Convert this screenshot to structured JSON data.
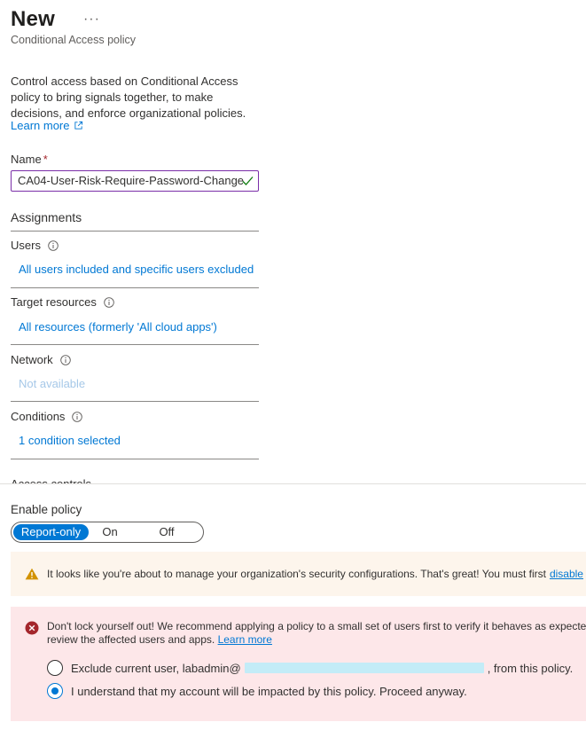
{
  "header": {
    "title": "New",
    "more": "···",
    "subtitle": "Conditional Access policy"
  },
  "description": {
    "text": "Control access based on Conditional Access policy to bring signals together, to make decisions, and enforce organizational policies.",
    "learn_more": "Learn more"
  },
  "name_field": {
    "label": "Name",
    "required_mark": "*",
    "value": "CA04-User-Risk-Require-Password-Change"
  },
  "assignments": {
    "heading": "Assignments",
    "sections": [
      {
        "label": "Users",
        "link": "All users included and specific users excluded"
      },
      {
        "label": "Target resources",
        "link": "All resources (formerly 'All cloud apps')"
      },
      {
        "label": "Network",
        "link": "Not available"
      },
      {
        "label": "Conditions",
        "link": "1 condition selected"
      }
    ]
  },
  "access_controls_partial": "Access controls",
  "enable_policy": {
    "label": "Enable policy",
    "options": [
      "Report-only",
      "On",
      "Off"
    ],
    "selected": "Report-only"
  },
  "warning": {
    "text": "It looks like you're about to manage your organization's security configurations. That's great! You must first",
    "link": "disable"
  },
  "error": {
    "line1": "Don't lock yourself out! We recommend applying a policy to a small set of users first to verify it behaves as expecte",
    "line2": "review the affected users and apps.",
    "link": "Learn more",
    "option_exclude_prefix": "Exclude current user, labadmin@",
    "option_exclude_suffix": ", from this policy.",
    "option_proceed": "I understand that my account will be impacted by this policy. Proceed anyway.",
    "selected_option": "proceed"
  },
  "colors": {
    "link": "#0078d4",
    "toggle_active": "#0078d4",
    "input_border": "#7a2ea8",
    "warning_bg": "#fdf5ec",
    "error_bg": "#fde7e9"
  }
}
